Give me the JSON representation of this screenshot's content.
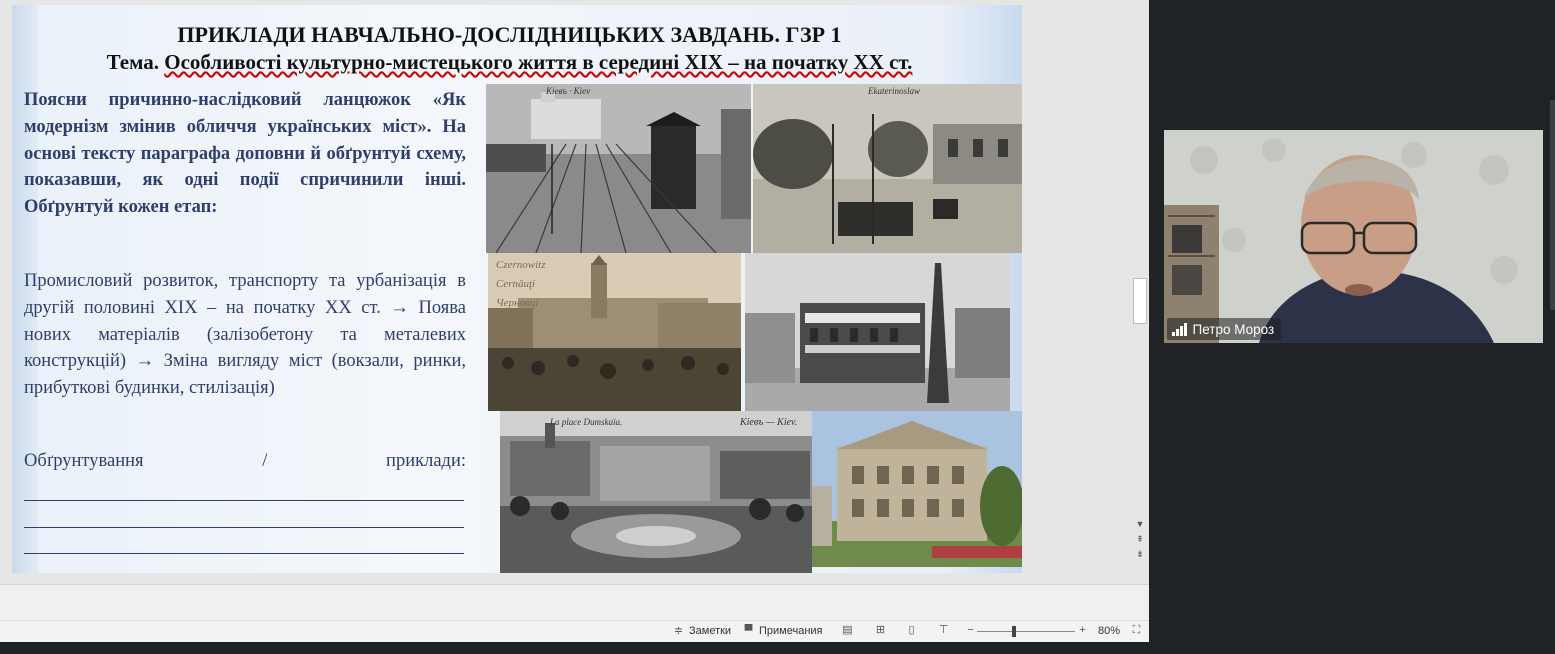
{
  "slide": {
    "title": "ПРИКЛАДИ НАВЧАЛЬНО-ДОСЛІДНИЦЬКИХ ЗАВДАНЬ. ГЗР 1",
    "topic_prefix": "Тема. ",
    "topic_text": "Особливості культурно-мистецького життя в середині XIX – на початку XX ст.",
    "task_text": "Поясни причинно-наслідковий ланцюжок «Як модернізм змінив обличчя українських міст». На основі тексту параграфа доповни й обґрунтуй схему, показавши, як одні події спричинили інші. Обґрунтуй кожен етап:",
    "chain_text": "Промисловий розвиток, транспорту та урбанізація в другій половині XIX – на початку XX ст. → Поява нових матеріалів (залізобетону та металевих конструкцій) → Зміна вигляду міст (вокзали, ринки, прибуткові будинки, стилізація)",
    "justification_label": "Обґрунтування",
    "justification_sep": "/",
    "justification_examples": "приклади:",
    "photo_captions": {
      "kiev_station": "Кіевъ · Kiev",
      "ekaterinoslav": "Ekaterinoslaw",
      "czernowitz_1": "Czernowitz",
      "czernowitz_2": "Cernăuţi",
      "czernowitz_3": "Черновці",
      "dumskaja": "La place Dumskaïa.",
      "kiev_dumskaja": "Кіевъ — Kiev."
    }
  },
  "statusbar": {
    "notes_label": "Заметки",
    "comments_label": "Примечания",
    "zoom": "80%",
    "zoom_level": 0.38
  },
  "video": {
    "participant_name": "Петро Мороз"
  },
  "colors": {
    "slide_text": "#2f3e6a",
    "title_text": "#111111",
    "panel_bg": "#1f2326"
  }
}
